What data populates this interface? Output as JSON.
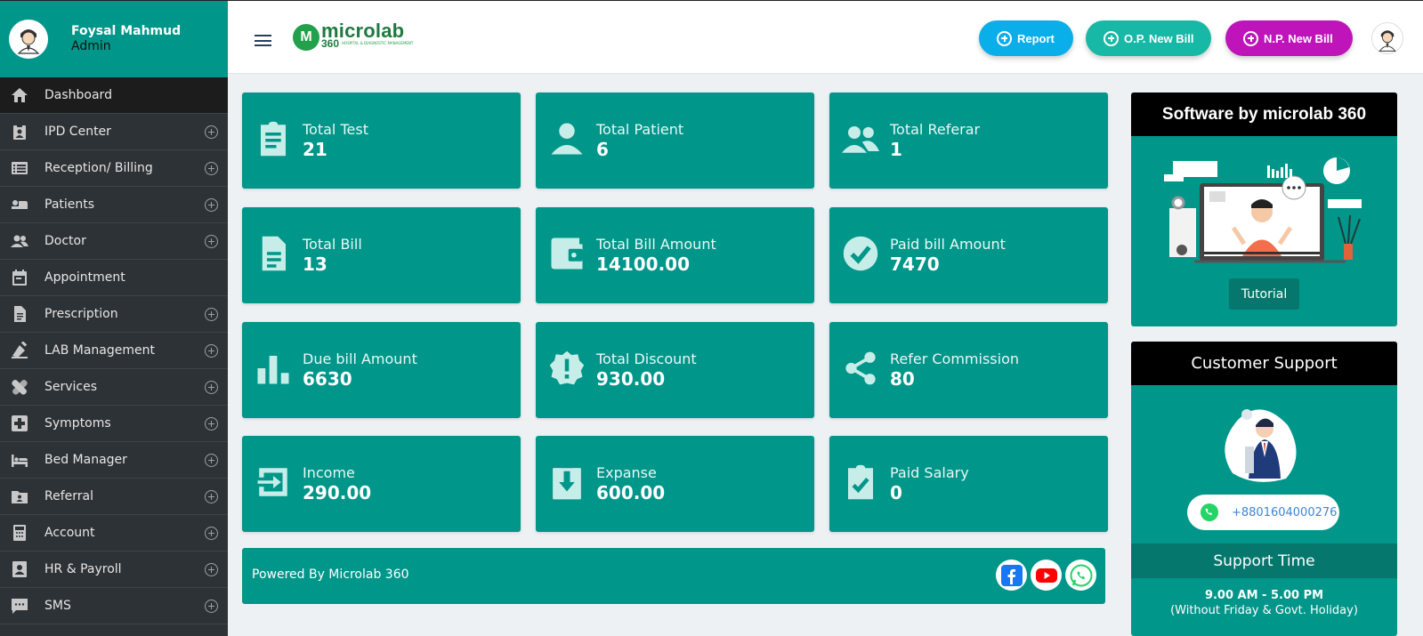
{
  "user": {
    "name": "Foysal Mahmud",
    "role": "Admin"
  },
  "sidebar": {
    "items": [
      {
        "label": "Dashboard",
        "icon": "home-icon",
        "expandable": false,
        "active": true
      },
      {
        "label": "IPD Center",
        "icon": "badge-icon",
        "expandable": true
      },
      {
        "label": "Reception/ Billing",
        "icon": "list-icon",
        "expandable": true
      },
      {
        "label": "Patients",
        "icon": "bed-patient-icon",
        "expandable": true
      },
      {
        "label": "Doctor",
        "icon": "people-icon",
        "expandable": true
      },
      {
        "label": "Appointment",
        "icon": "calendar-icon",
        "expandable": false
      },
      {
        "label": "Prescription",
        "icon": "document-icon",
        "expandable": true
      },
      {
        "label": "LAB Management",
        "icon": "flask-icon",
        "expandable": true
      },
      {
        "label": "Services",
        "icon": "bandage-icon",
        "expandable": true
      },
      {
        "label": "Symptoms",
        "icon": "medical-plus-icon",
        "expandable": true
      },
      {
        "label": "Bed Manager",
        "icon": "bed-icon",
        "expandable": true
      },
      {
        "label": "Referral",
        "icon": "folder-user-icon",
        "expandable": true
      },
      {
        "label": "Account",
        "icon": "calculator-icon",
        "expandable": true
      },
      {
        "label": "HR & Payroll",
        "icon": "id-card-icon",
        "expandable": true
      },
      {
        "label": "SMS",
        "icon": "chat-icon",
        "expandable": true
      }
    ]
  },
  "header": {
    "logo_main": "microlab",
    "logo_sub": "360",
    "logo_tagline": "HOSPITAL & DIAGNOSTIC MANAGEMENT",
    "buttons": {
      "report": "Report",
      "op_new_bill": "O.P. New Bill",
      "np_new_bill": "N.P. New Bill"
    }
  },
  "stats": [
    {
      "label": "Total Test",
      "value": "21",
      "icon": "clipboard-list-icon"
    },
    {
      "label": "Total Patient",
      "value": "6",
      "icon": "person-icon"
    },
    {
      "label": "Total Referar",
      "value": "1",
      "icon": "group-icon"
    },
    {
      "label": "Total Bill",
      "value": "13",
      "icon": "file-icon"
    },
    {
      "label": "Total Bill Amount",
      "value": "14100.00",
      "icon": "wallet-icon"
    },
    {
      "label": "Paid bill Amount",
      "value": "7470",
      "icon": "check-circle-icon"
    },
    {
      "label": "Due bill Amount",
      "value": "6630",
      "icon": "bar-chart-icon"
    },
    {
      "label": "Total Discount",
      "value": "930.00",
      "icon": "alert-badge-icon"
    },
    {
      "label": "Refer Commission",
      "value": "80",
      "icon": "share-icon"
    },
    {
      "label": "Income",
      "value": "290.00",
      "icon": "login-icon"
    },
    {
      "label": "Expanse",
      "value": "600.00",
      "icon": "download-box-icon"
    },
    {
      "label": "Paid Salary",
      "value": "0",
      "icon": "clipboard-check-icon"
    }
  ],
  "footer": {
    "powered": "Powered By Microlab 360"
  },
  "tutorial_panel": {
    "title": "Software by microlab 360",
    "button": "Tutorial"
  },
  "support_panel": {
    "title": "Customer Support",
    "phone": "+8801604000276",
    "time_title": "Support Time",
    "hours": "9.00 AM - 5.00 PM",
    "note": "(Without Friday & Govt. Holiday)"
  },
  "colors": {
    "primary": "#00968a",
    "sidebar": "#2d3236",
    "report": "#0aaee8",
    "op": "#17b9a6",
    "np": "#be14b9"
  }
}
